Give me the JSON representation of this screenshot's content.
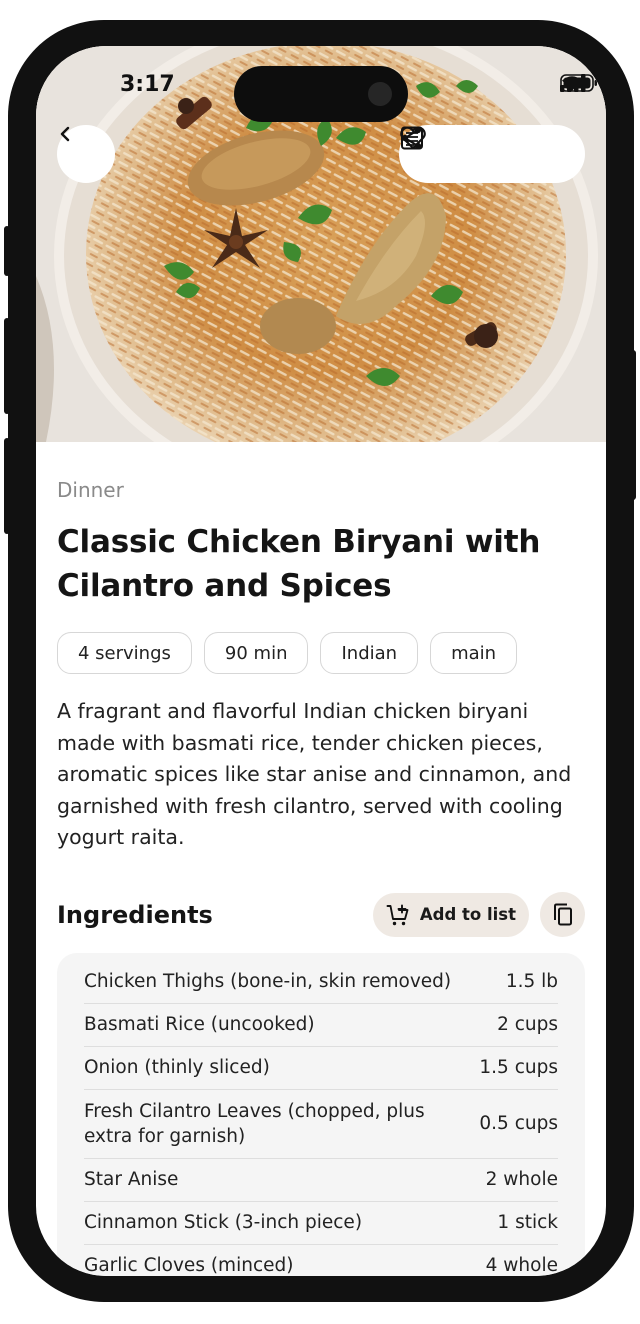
{
  "status_bar": {
    "time": "3:17"
  },
  "header": {
    "back_icon": "chevron-left-icon",
    "actions": [
      "share-icon",
      "reader-icon",
      "heart-icon"
    ]
  },
  "recipe": {
    "category": "Dinner",
    "title": "Classic Chicken Biryani with Cilantro and Spices",
    "tags": [
      "4 servings",
      "90 min",
      "Indian",
      "main"
    ],
    "description": "A fragrant and flavorful Indian chicken biryani made with basmati rice, tender chicken pieces, aromatic spices like star anise and cinnamon, and garnished with fresh cilantro, served with cooling yogurt raita."
  },
  "ingredients": {
    "title": "Ingredients",
    "add_to_list_label": "Add to list",
    "items": [
      {
        "name": "Chicken Thighs (bone-in, skin removed)",
        "qty": "1.5 lb"
      },
      {
        "name": "Basmati Rice (uncooked)",
        "qty": "2 cups"
      },
      {
        "name": "Onion (thinly sliced)",
        "qty": "1.5 cups"
      },
      {
        "name": "Fresh Cilantro Leaves (chopped, plus extra for garnish)",
        "qty": "0.5 cups"
      },
      {
        "name": "Star Anise",
        "qty": "2 whole"
      },
      {
        "name": "Cinnamon Stick (3-inch piece)",
        "qty": "1 stick"
      },
      {
        "name": "Garlic Cloves (minced)",
        "qty": "4 whole"
      }
    ]
  }
}
